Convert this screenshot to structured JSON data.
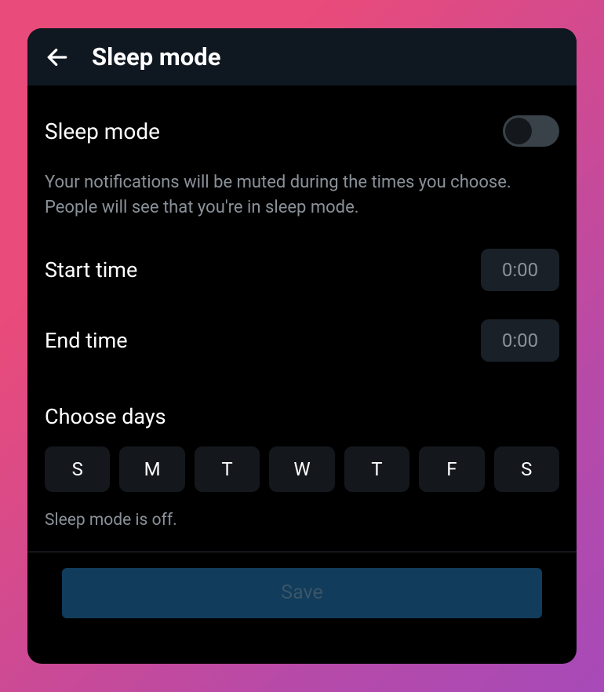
{
  "header": {
    "title": "Sleep mode"
  },
  "sleepMode": {
    "toggleLabel": "Sleep mode",
    "enabled": false,
    "description": "Your notifications will be muted during the times you choose. People will see that you're in sleep mode."
  },
  "startTime": {
    "label": "Start time",
    "value": "0:00"
  },
  "endTime": {
    "label": "End time",
    "value": "0:00"
  },
  "chooseDays": {
    "label": "Choose days",
    "days": [
      "S",
      "M",
      "T",
      "W",
      "T",
      "F",
      "S"
    ]
  },
  "status": "Sleep mode is off.",
  "saveButton": {
    "label": "Save"
  },
  "colors": {
    "background": "#000000",
    "headerBg": "#0f1721",
    "text": "#ffffff",
    "muted": "#8a9199",
    "chipBg": "#14181d",
    "saveBg": "#113c5c"
  }
}
